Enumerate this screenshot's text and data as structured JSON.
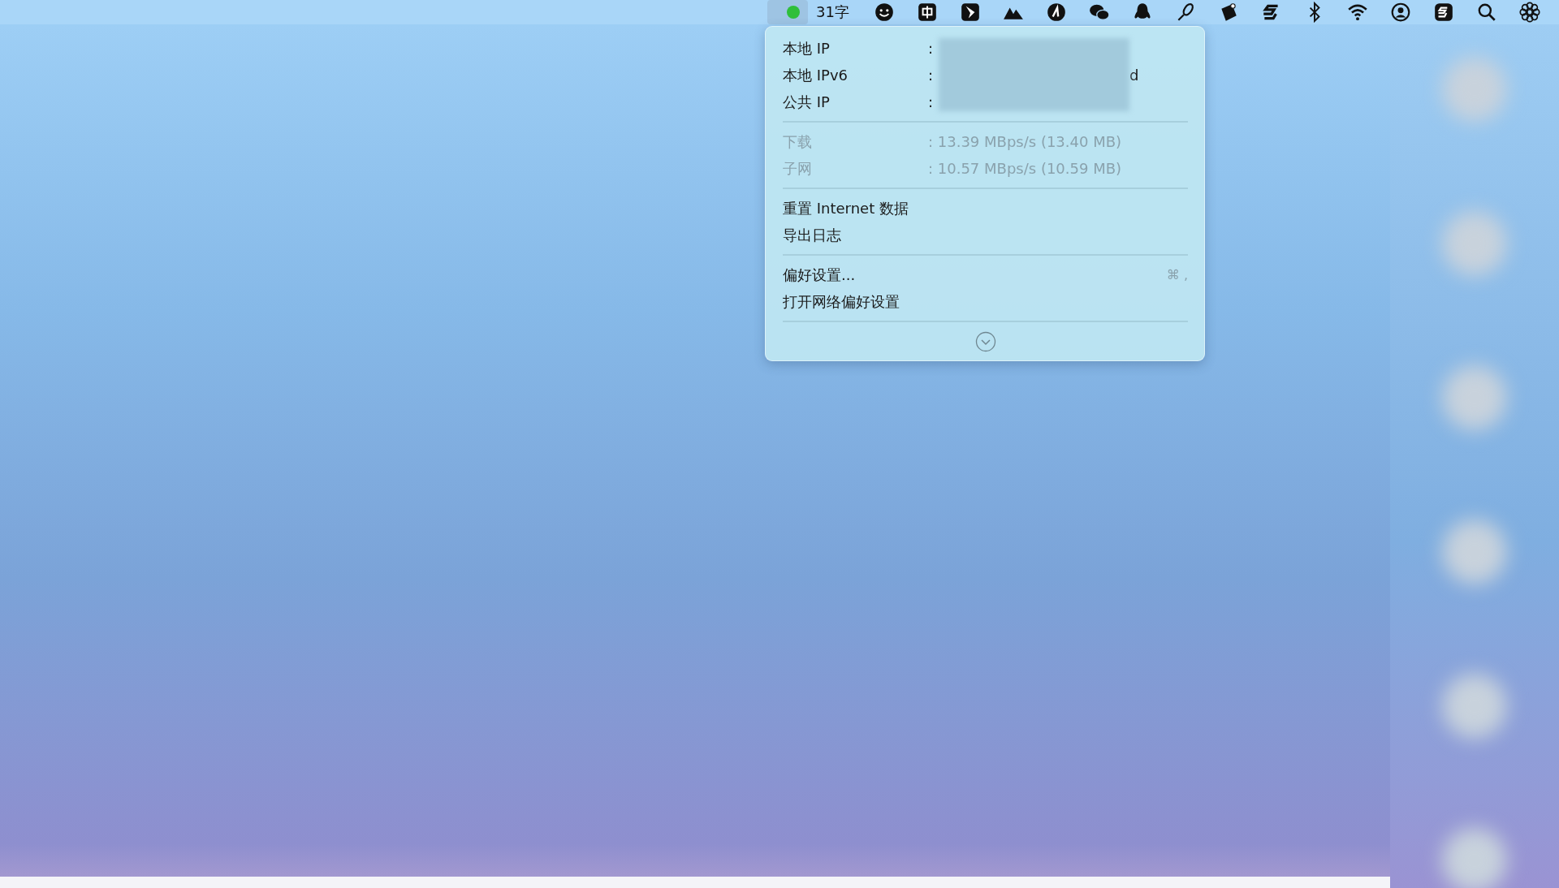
{
  "menu_bar": {
    "status_text": "31字"
  },
  "menu": {
    "info_rows": [
      {
        "label": "本地 IP",
        "value": ":",
        "redacted": true,
        "value_suffix": ""
      },
      {
        "label": "本地 IPv6",
        "value": ":",
        "redacted": true,
        "value_suffix": "d"
      },
      {
        "label": "公共 IP",
        "value": ":",
        "redacted": true,
        "value_suffix": ""
      }
    ],
    "stat_rows": [
      {
        "label": "下载",
        "value": ": 13.39 MBps/s (13.40 MB)",
        "disabled": true
      },
      {
        "label": "子网",
        "value": ": 10.57 MBps/s (10.59 MB)",
        "disabled": true
      }
    ],
    "action_groups": [
      [
        {
          "label": "重置 Internet 数据"
        },
        {
          "label": "导出日志"
        }
      ],
      [
        {
          "label": "偏好设置...",
          "shortcut": "⌘ ,"
        },
        {
          "label": "打开网络偏好设置"
        }
      ]
    ]
  }
}
